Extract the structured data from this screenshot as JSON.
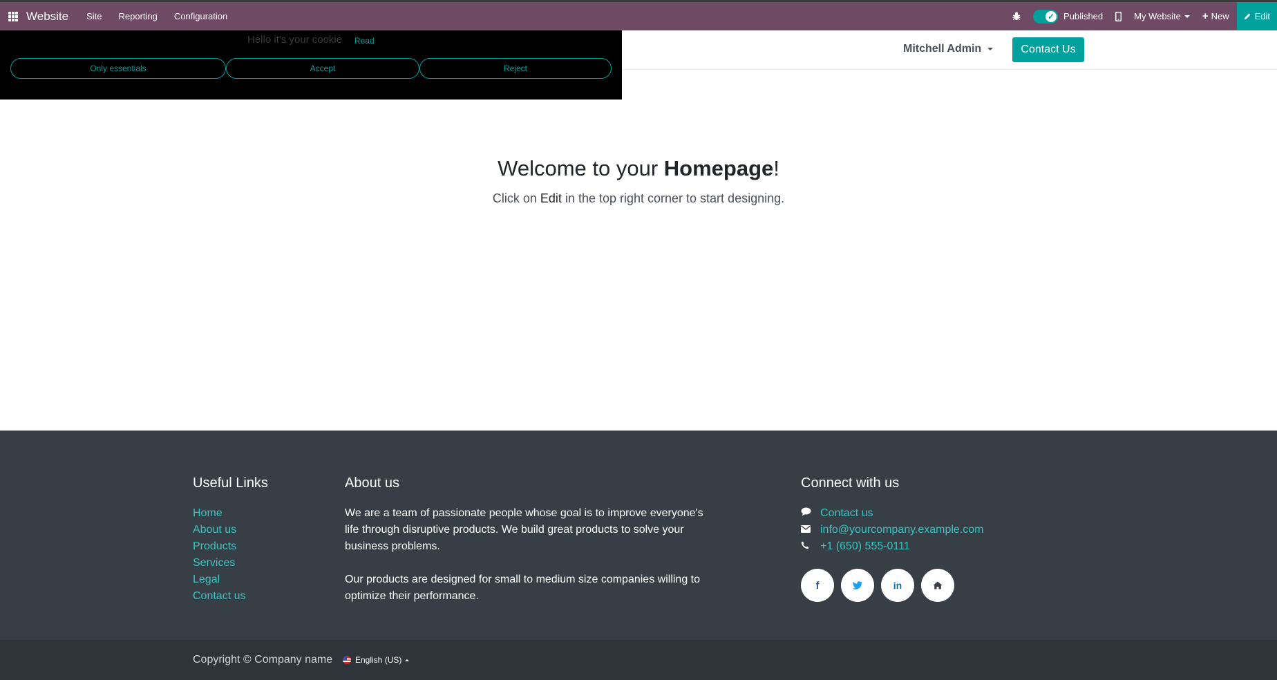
{
  "topbar": {
    "brand": "Website",
    "menu": [
      "Site",
      "Reporting",
      "Configuration"
    ],
    "published_label": "Published",
    "website_selector": "My Website",
    "new_label": "New",
    "edit_label": "Edit",
    "colors": {
      "bar": "#6e4a64",
      "accent": "#00a09d"
    }
  },
  "header": {
    "user_name": "Mitchell Admin",
    "contact_button": "Contact Us"
  },
  "cookie_bar": {
    "message": "Hello it's your cookie",
    "read_link": "Read",
    "buttons": [
      "Only essentials",
      "Accept",
      "Reject"
    ]
  },
  "hero": {
    "title_prefix": "Welcome to your ",
    "title_bold": "Homepage",
    "title_suffix": "!",
    "sub_prefix": "Click on ",
    "sub_bold": "Edit",
    "sub_suffix": " in the top right corner to start designing."
  },
  "footer": {
    "useful_links": {
      "title": "Useful Links",
      "items": [
        "Home",
        "About us",
        "Products",
        "Services",
        "Legal",
        "Contact us"
      ]
    },
    "about": {
      "title": "About us",
      "paragraphs": [
        "We are a team of passionate people whose goal is to improve everyone's life through disruptive products. We build great products to solve your business problems.",
        "Our products are designed for small to medium size companies willing to optimize their performance."
      ]
    },
    "connect": {
      "title": "Connect with us",
      "contact": "Contact us",
      "email": "info@yourcompany.example.com",
      "phone": "+1 (650) 555-0111",
      "socials": [
        "facebook-icon",
        "twitter-icon",
        "linkedin-icon",
        "home-icon"
      ]
    }
  },
  "copyright": {
    "text": "Copyright © Company name",
    "language": "English (US)"
  }
}
